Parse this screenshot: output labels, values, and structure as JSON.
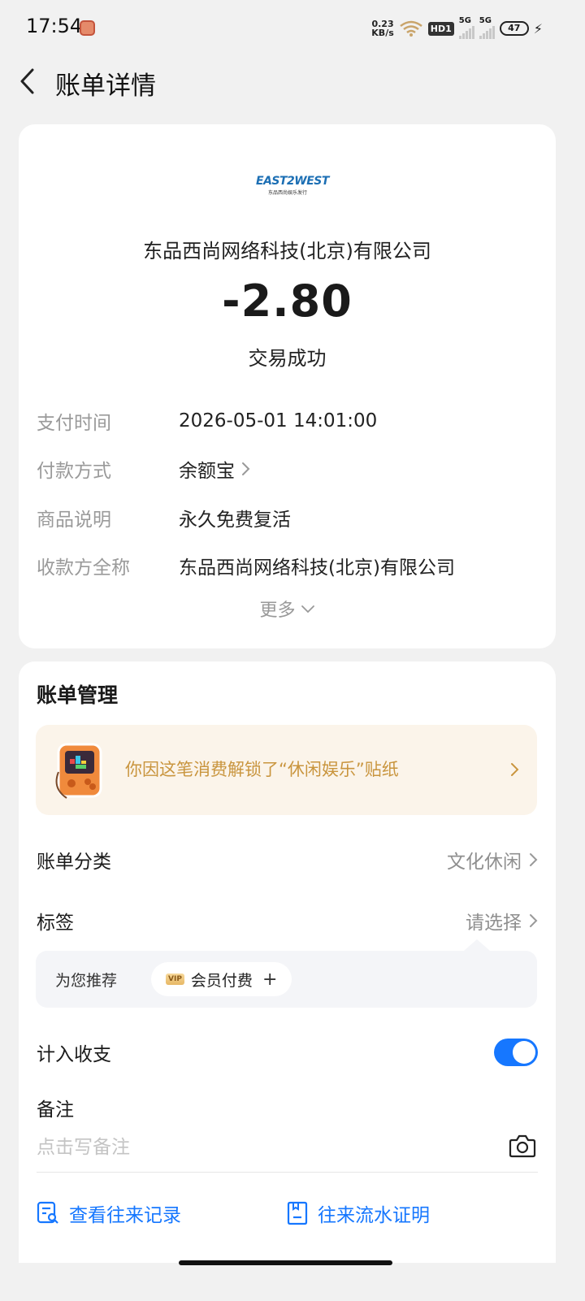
{
  "status_bar": {
    "time": "17:54",
    "net_speed_top": "0.23",
    "net_speed_bottom": "KB/s",
    "hd": "HD1",
    "sim1": "5G",
    "sim2": "5G",
    "battery": "47"
  },
  "header": {
    "title": "账单详情"
  },
  "summary": {
    "merchant": "东品西尚网络科技(北京)有限公司",
    "amount": "-2.80",
    "status": "交易成功",
    "logo_text": "EAST2WEST",
    "logo_subtext": "东品西尚娱乐发行"
  },
  "details": {
    "pay_time_label": "支付时间",
    "pay_time_value": "2026-05-01 14:01:00",
    "pay_method_label": "付款方式",
    "pay_method_value": "余额宝",
    "goods_label": "商品说明",
    "goods_value": "永久免费复活",
    "payee_label": "收款方全称",
    "payee_value": "东品西尚网络科技(北京)有限公司",
    "more": "更多"
  },
  "management": {
    "title": "账单管理",
    "promo_text": "你因这笔消费解锁了“休闲娱乐”贴纸",
    "category_label": "账单分类",
    "category_value": "文化休闲",
    "tag_label": "标签",
    "tag_value": "请选择",
    "recommend_label": "为您推荐",
    "recommend_chip_badge": "VIP",
    "recommend_chip": "会员付费",
    "recommend_chip_plus": "+",
    "include_label": "计入收支",
    "include_on": true,
    "remark_label": "备注",
    "remark_placeholder": "点击写备注",
    "link_history": "查看往来记录",
    "link_proof": "往来流水证明"
  },
  "colors": {
    "accent": "#1677ff",
    "promo_text": "#c9953e",
    "promo_bg": "#fbf4ea"
  }
}
